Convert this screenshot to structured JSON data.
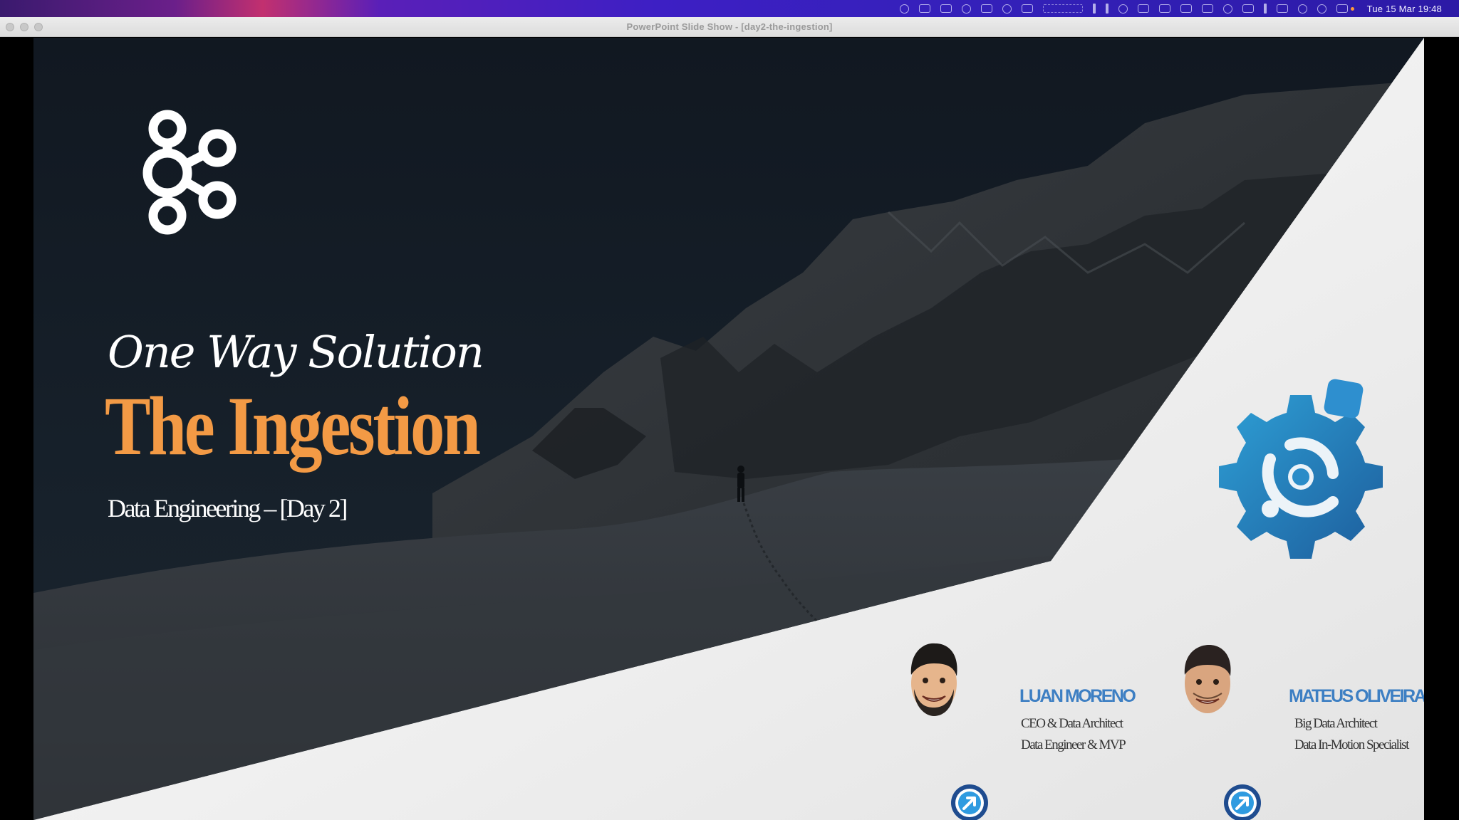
{
  "menubar": {
    "clock": "Tue 15 Mar  19:48"
  },
  "window": {
    "title": "PowerPoint Slide Show - [day2-the-ingestion]"
  },
  "slide": {
    "headline": "One Way Solution",
    "title": "The Ingestion",
    "subtitle": "Data Engineering – [Day 2]",
    "title_color": "#f39a45",
    "presenters": [
      {
        "name": "LUAN MORENO",
        "roles": [
          "CEO & Data Architect",
          "Data Engineer & MVP"
        ],
        "link_icon": "external-link-icon"
      },
      {
        "name": "MATEUS OLIVEIRA",
        "roles": [
          "Big Data Architect",
          "Data In-Motion Specialist"
        ],
        "link_icon": "external-link-icon"
      }
    ]
  },
  "colors": {
    "accent_orange": "#f39a45",
    "name_blue": "#3d7fc3",
    "slide_dark": "#141c26"
  }
}
